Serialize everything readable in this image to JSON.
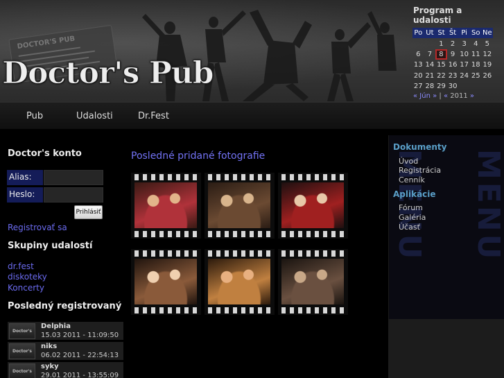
{
  "header": {
    "logo_text": "Doctor's Pub",
    "sign_text": "DOCTOR'S PUB"
  },
  "calendar": {
    "title": "Program a udalosti",
    "weekdays": [
      "Po",
      "Ut",
      "St",
      "Št",
      "Pi",
      "So",
      "Ne"
    ],
    "weeks": [
      [
        "",
        "",
        "",
        "",
        "",
        "",
        ""
      ],
      [
        "",
        "",
        "",
        "1",
        "2",
        "3",
        "4",
        "5"
      ],
      [
        "6",
        "7",
        "8",
        "9",
        "10",
        "11",
        "12"
      ],
      [
        "13",
        "14",
        "15",
        "16",
        "17",
        "18",
        "19"
      ],
      [
        "20",
        "21",
        "22",
        "23",
        "24",
        "25",
        "26"
      ],
      [
        "27",
        "28",
        "29",
        "30",
        "",
        "",
        ""
      ]
    ],
    "today": "8",
    "nav_prev": "« Jún »",
    "nav_sep": "|",
    "nav_year_prev": "«",
    "nav_year": "2011",
    "nav_year_next": "»"
  },
  "nav": {
    "items": [
      "Pub",
      "Udalosti",
      "Dr.Fest"
    ]
  },
  "login": {
    "heading": "Doctor's konto",
    "alias_label": "Alias:",
    "password_label": "Heslo:",
    "submit_label": "Prihlásiť",
    "register_link": "Registrovať sa"
  },
  "groups": {
    "heading": "Skupiny udalostí",
    "items": [
      "dr.fest",
      "diskoteky",
      "Koncerty"
    ]
  },
  "last_registered": {
    "heading": "Posledný registrovaný",
    "thumb_text": "Doctor's Pub",
    "items": [
      {
        "name": "Delphia",
        "date": "15.03 2011 - 11:09:50"
      },
      {
        "name": "niks",
        "date": "06.02 2011 - 22:54:13"
      },
      {
        "name": "syky",
        "date": "29.01 2011 - 13:55:09"
      }
    ]
  },
  "main": {
    "title": "Posledné pridané fotografie",
    "photo_count": 6
  },
  "rightbar": {
    "bg_text": "MENU",
    "sections": [
      {
        "heading": "Dokumenty",
        "links": [
          "Úvod",
          "Registrácia",
          "Cenník"
        ]
      },
      {
        "heading": "Aplikácie",
        "links": [
          "Fórum",
          "Galéria",
          "Účasť"
        ]
      }
    ]
  },
  "colors": {
    "link": "#6b6bf0",
    "title_blue": "#7373f5",
    "right_heading": "#5a9fc8",
    "weekday_bg": "#1b2a6e",
    "today_border": "#b52828"
  }
}
